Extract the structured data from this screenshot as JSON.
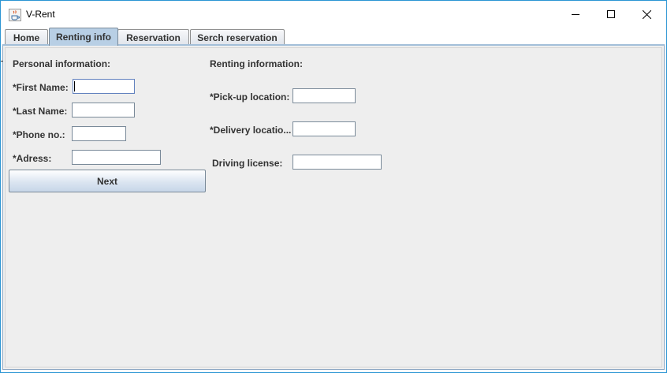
{
  "window": {
    "title": "V-Rent"
  },
  "tabs": [
    {
      "label": "Home",
      "active": false
    },
    {
      "label": "Renting info",
      "active": true
    },
    {
      "label": "Reservation",
      "active": false
    },
    {
      "label": "Serch reservation",
      "active": false
    }
  ],
  "personal": {
    "heading": "Personal information:",
    "first_name_label": "*First Name:",
    "first_name_value": "",
    "last_name_label": "*Last Name:",
    "last_name_value": "",
    "phone_label": "*Phone no.:",
    "phone_value": "",
    "address_label": "*Adress:",
    "address_value": "",
    "next_label": "Next"
  },
  "renting": {
    "heading": "Renting information:",
    "pickup_label": "*Pick-up location:",
    "pickup_value": "",
    "delivery_label": "*Delivery locatio...",
    "delivery_value": "",
    "license_label": "Driving license:",
    "license_value": ""
  },
  "icons": {
    "app": "java-cup-icon",
    "minimize": "minimize-icon",
    "maximize": "maximize-icon",
    "close": "close-icon"
  },
  "colors": {
    "window_border": "#2b95d3",
    "panel_bg": "#eeeeee",
    "active_tab": "#b8cfe5",
    "text": "#333333"
  }
}
